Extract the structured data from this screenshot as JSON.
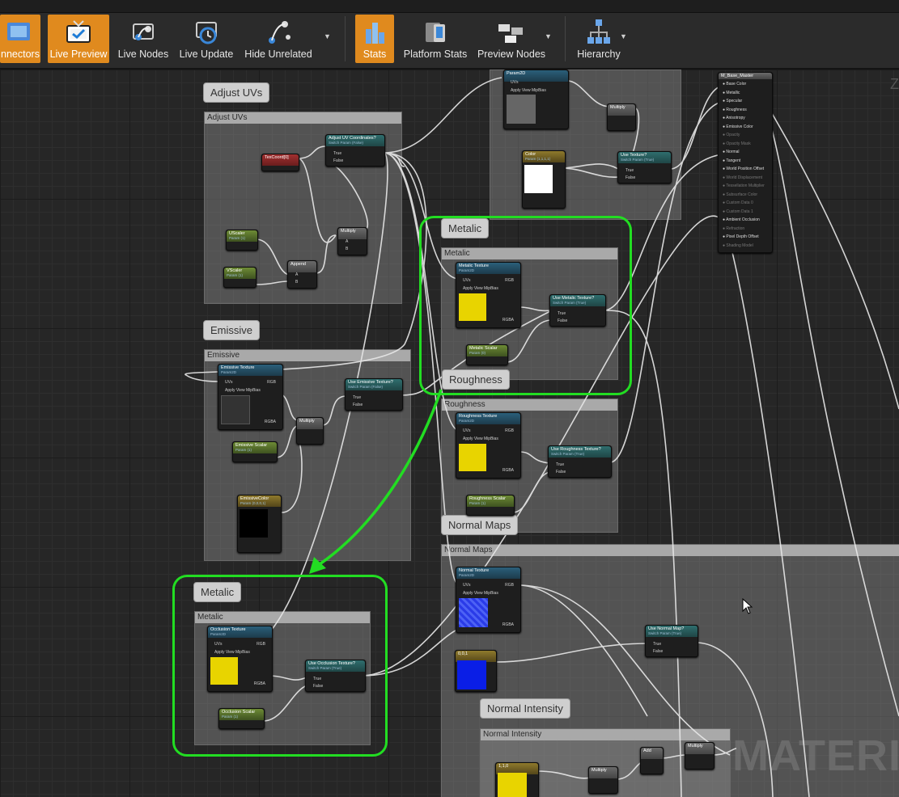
{
  "toolbar": {
    "items": [
      {
        "label": "nnectors",
        "active": true
      },
      {
        "label": "Live Preview",
        "active": true
      },
      {
        "label": "Live Nodes",
        "active": false
      },
      {
        "label": "Live Update",
        "active": false
      },
      {
        "label": "Hide Unrelated",
        "active": false
      },
      {
        "label": "Stats",
        "active": true
      },
      {
        "label": "Platform Stats",
        "active": false
      },
      {
        "label": "Preview Nodes",
        "active": false
      },
      {
        "label": "Hierarchy",
        "active": false
      }
    ]
  },
  "comments": {
    "adjust_uvs": {
      "bubble": "Adjust UVs",
      "title": "Adjust UVs"
    },
    "emissive": {
      "bubble": "Emissive",
      "title": "Emissive"
    },
    "metalic": {
      "bubble": "Metalic",
      "title": "Metalic"
    },
    "roughness": {
      "bubble": "Roughness",
      "title": "Roughness"
    },
    "normal_maps": {
      "bubble": "Normal Maps",
      "title": "Normal Maps"
    },
    "metalic_copy": {
      "bubble": "Metalic",
      "title": "Metalic"
    },
    "normal_intensity": {
      "bubble": "Normal Intensity",
      "title": "Normal Intensity"
    }
  },
  "nodes": {
    "texcoord": {
      "title": "TexCoord[0]"
    },
    "adjust_uv_switch": {
      "title": "Adjust UV Coordinates?",
      "sub": "Switch Param (False)"
    },
    "uscaler": {
      "title": "UScaler",
      "sub": "Param (1)"
    },
    "vscaler": {
      "title": "VScaler",
      "sub": "Param (1)"
    },
    "append": {
      "title": "Append"
    },
    "multiply_uv": {
      "title": "Multiply"
    },
    "emissive_texture": {
      "title": "Emissive Texture",
      "sub": "Param2D"
    },
    "emissive_scalar": {
      "title": "Emissive Scalar",
      "sub": "Param (1)"
    },
    "emissive_color": {
      "title": "EmissiveColor",
      "sub": "Param (0,0,0,1)"
    },
    "multiply_em": {
      "title": "Multiply"
    },
    "use_emissive": {
      "title": "Use Emissive Texture?",
      "sub": "Switch Param (False)"
    },
    "metalic_texture": {
      "title": "Metalic Texture",
      "sub": "Param2D"
    },
    "metalic_scalar": {
      "title": "Metalic Scalar",
      "sub": "Param (0)"
    },
    "use_metalic": {
      "title": "Use Metalic Texture?",
      "sub": "Switch Param (True)"
    },
    "roughness_texture": {
      "title": "Roughness Texture",
      "sub": "Param2D"
    },
    "roughness_scalar": {
      "title": "Roughness Scalar",
      "sub": "Param (1)"
    },
    "use_roughness": {
      "title": "Use Roughness Texture?",
      "sub": "Switch Param (True)"
    },
    "normal_texture": {
      "title": "Normal Texture",
      "sub": "Param2D"
    },
    "normal_const": {
      "title": "0,0,1"
    },
    "use_normal": {
      "title": "Use Normal Map?",
      "sub": "Switch Param (True)"
    },
    "occlusion_texture": {
      "title": "Occlusion Texture",
      "sub": "Param2D"
    },
    "occlusion_scalar": {
      "title": "Occlusion Scalar",
      "sub": "Param (1)"
    },
    "use_occlusion": {
      "title": "Use Occlusion Texture?",
      "sub": "Switch Param (True)"
    },
    "param2d_top": {
      "title": "Param2D"
    },
    "color_param": {
      "title": "Color",
      "sub": "Param (1,1,1,1)"
    },
    "multiply_top": {
      "title": "Multiply"
    },
    "use_texture": {
      "title": "Use Texture?",
      "sub": "Switch Param (True)"
    },
    "const_110": {
      "title": "1,1,0"
    },
    "multiply_ni1": {
      "title": "Multiply"
    },
    "add_ni": {
      "title": "Add"
    },
    "multiply_ni2": {
      "title": "Multiply"
    },
    "base_master": {
      "title": "M_Base_Master"
    }
  },
  "pins": {
    "uvs": "UVs",
    "apply_mip": "Apply View MipBias",
    "rgb": "RGB",
    "r": "R",
    "g": "G",
    "b": "B",
    "a": "A",
    "rgba": "RGBA",
    "true": "True",
    "false": "False"
  },
  "master_pins": [
    "Base Color",
    "Metallic",
    "Specular",
    "Roughness",
    "Anisotropy",
    "Emissive Color",
    "Opacity",
    "Opacity Mask",
    "Normal",
    "Tangent",
    "World Position Offset",
    "World Displacement",
    "Tessellation Multiplier",
    "Subsurface Color",
    "Custom Data 0",
    "Custom Data 1",
    "Ambient Occlusion",
    "Refraction",
    "Pixel Depth Offset",
    "Shading Model"
  ],
  "watermark": "MATERIA",
  "corner_letter": "Z",
  "colors": {
    "highlight": "#22dd22",
    "toolbar_active": "#e08a1e",
    "yellow_swatch": "#e8d400",
    "blue_swatch": "#0a1ee6"
  }
}
